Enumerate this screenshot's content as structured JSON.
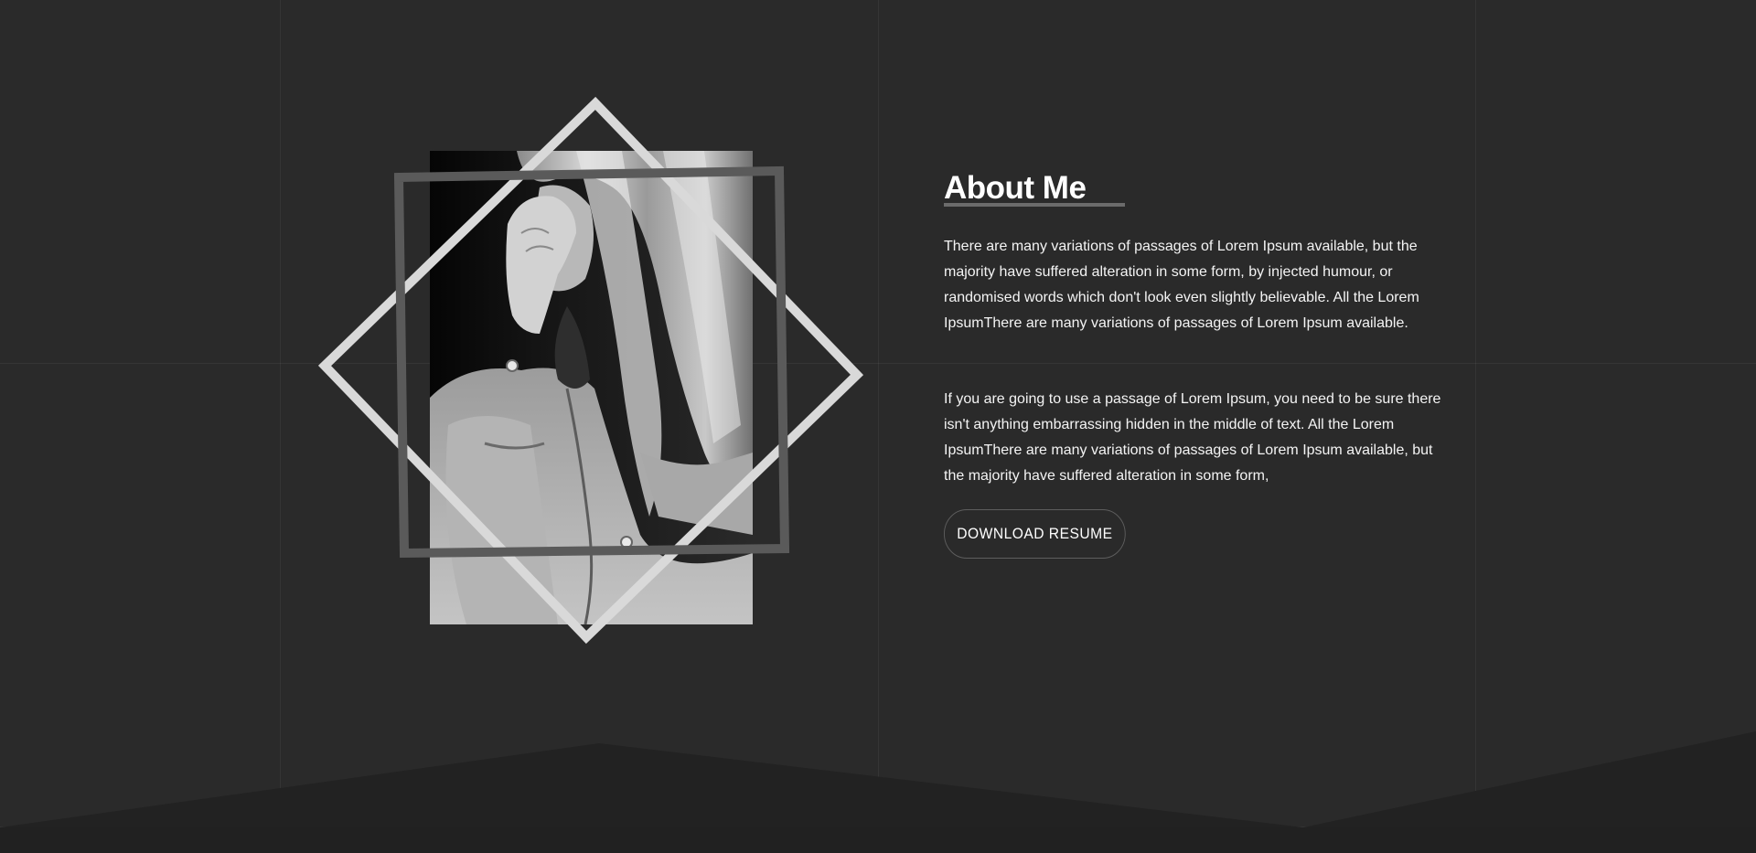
{
  "about": {
    "title": "About Me",
    "paragraph1": "There are many variations of passages of Lorem Ipsum available, but the majority have suffered alteration in some form, by injected humour, or randomised words which don't look even slightly believable. All the Lorem IpsumThere are many variations of passages of Lorem Ipsum available.",
    "paragraph2": "If you are going to use a passage of Lorem Ipsum, you need to be sure there isn't anything embarrassing hidden in the middle of text. All the Lorem IpsumThere are many variations of passages of Lorem Ipsum available, but the majority have suffered alteration in some form,",
    "button_label": "DOWNLOAD RESUME"
  },
  "colors": {
    "background": "#2a2a2a",
    "bottom_shape": "#1f1f1f",
    "diamond_frame": "#d9d9d9",
    "square_frame": "#5a5a5a",
    "underline": "#6b6b6b"
  },
  "images": {
    "portrait": "portrait-photo"
  }
}
